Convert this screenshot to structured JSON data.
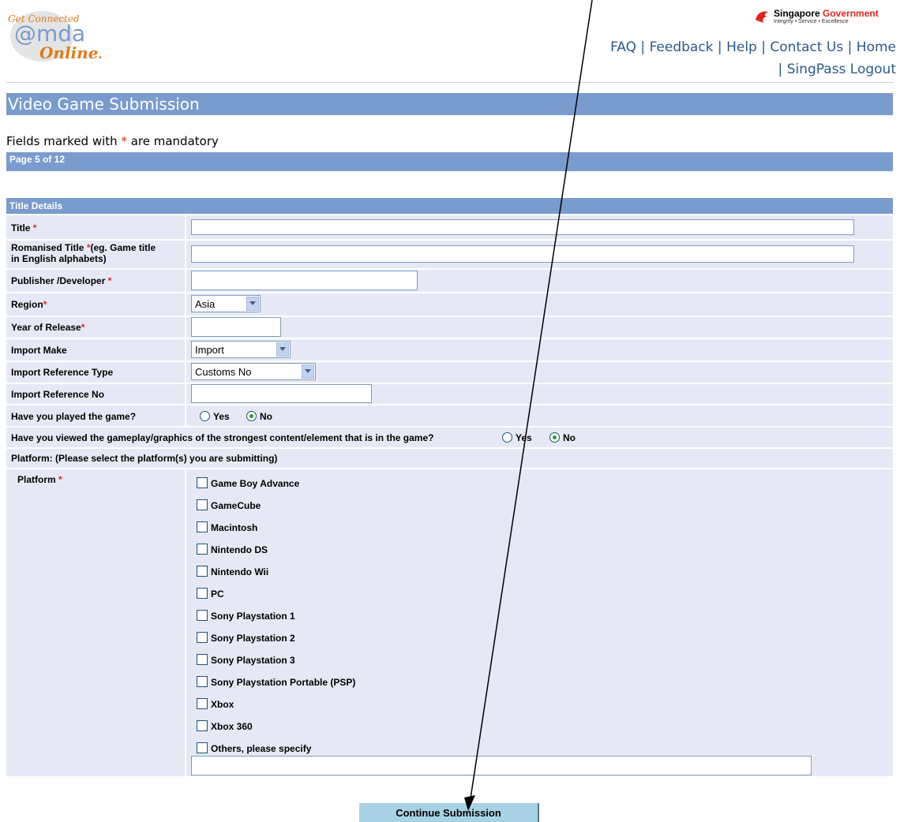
{
  "header": {
    "logo": {
      "tagline": "Get Connected",
      "brand": "@mda",
      "sub": "Online!"
    },
    "gov_name_part1": "Singapore ",
    "gov_name_part2": "Government",
    "gov_motto": "Integrity • Service • Excellence",
    "links": [
      "FAQ",
      "Feedback",
      "Help",
      "Contact Us",
      "Home",
      "SingPass Logout"
    ],
    "link_separator": " | "
  },
  "page": {
    "title": "Video Game Submission",
    "mandatory_prefix": "Fields marked with ",
    "mandatory_star": "*",
    "mandatory_suffix": " are mandatory",
    "page_indicator": "Page 5 of 12",
    "section_title": "Title Details"
  },
  "form": {
    "title_label": "Title ",
    "romanised_label": "Romanised Title ",
    "romanised_hint": "(eg. Game title",
    "romanised_hint2": "in English alphabets)",
    "publisher_label": "Publisher /Developer ",
    "region_label": "Region",
    "region_value": "Asia",
    "year_label": "Year of Release",
    "import_make_label": "Import Make",
    "import_make_value": "Import",
    "import_ref_type_label": "Import Reference Type",
    "import_ref_type_value": "Customs No",
    "import_ref_no_label": "Import Reference No",
    "played_label": "Have you played the game?",
    "played_value": "No",
    "viewed_label": "Have you viewed the gameplay/graphics of the strongest content/element that is in the game?",
    "viewed_value": "No",
    "yes": "Yes",
    "no": "No",
    "star": "*",
    "platform_heading": "Platform: (Please select the platform(s) you are submitting)",
    "platform_label": "Platform ",
    "platforms": [
      "Game Boy Advance",
      "GameCube",
      "Macintosh",
      "Nintendo DS",
      "Nintendo Wii",
      "PC",
      "Sony Playstation 1",
      "Sony Playstation 2",
      "Sony Playstation 3",
      "Sony Playstation Portable (PSP)",
      "Xbox",
      "Xbox 360",
      "Others, please specify"
    ]
  },
  "continue_label": "Continue Submission",
  "colors": {
    "bar": "#7a9bcd",
    "row": "#e6e9f5",
    "link": "#2a5a8a",
    "required": "#e0241b",
    "button": "#a9d1e5"
  }
}
